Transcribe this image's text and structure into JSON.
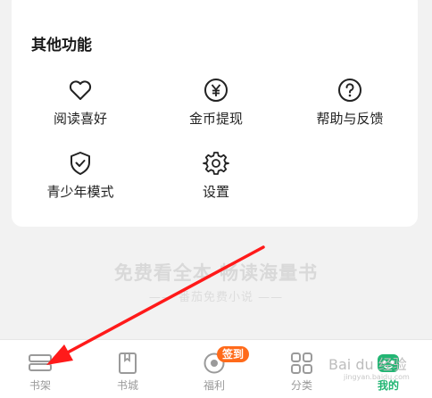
{
  "section": {
    "title": "其他功能",
    "items": [
      {
        "label": "阅读喜好",
        "icon": "heart-icon"
      },
      {
        "label": "金币提现",
        "icon": "yen-coin-icon"
      },
      {
        "label": "帮助与反馈",
        "icon": "help-icon"
      },
      {
        "label": "青少年模式",
        "icon": "shield-check-icon"
      },
      {
        "label": "设置",
        "icon": "gear-icon"
      }
    ]
  },
  "slogan": {
    "main": "免费看全本  畅读海量书",
    "sub": "—— 番茄免费小说 ——"
  },
  "tabbar": {
    "items": [
      {
        "label": "书架",
        "icon": "bookshelf-icon"
      },
      {
        "label": "书城",
        "icon": "book-icon"
      },
      {
        "label": "福利",
        "icon": "coin-icon",
        "badge": "签到"
      },
      {
        "label": "分类",
        "icon": "grid-icon"
      },
      {
        "label": "我的",
        "icon": "profile-icon",
        "active": true
      }
    ]
  },
  "watermark": {
    "text": "Bai du 经验",
    "sub": "jingyan.baidu.com"
  },
  "colors": {
    "accent": "#22b573",
    "badge": "#ff6a1a",
    "annotation_arrow": "#ff1a1a"
  }
}
